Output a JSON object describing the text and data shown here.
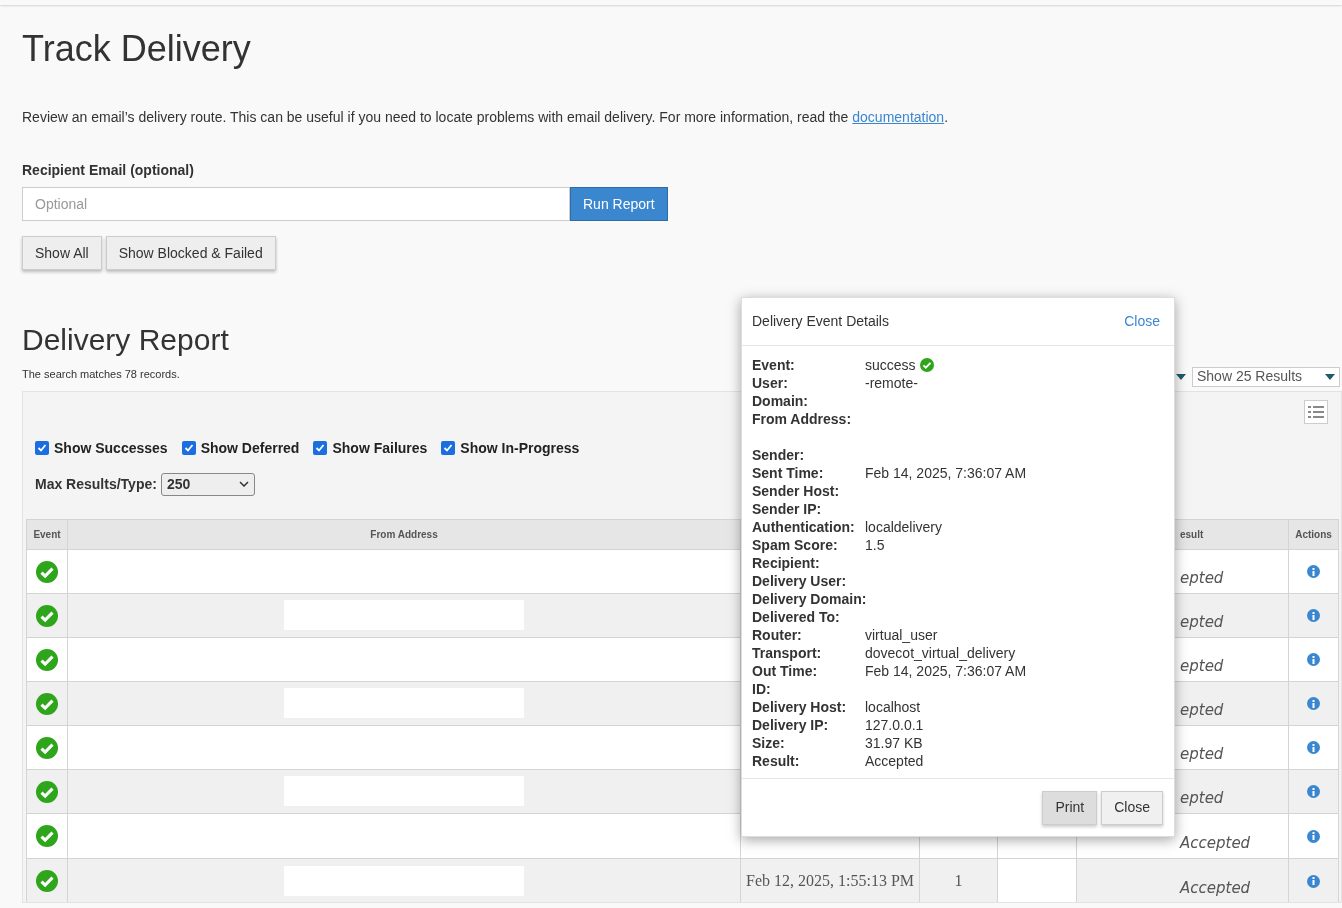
{
  "page": {
    "title": "Track Delivery",
    "description": "Review an email’s delivery route. This can be useful if you need to locate problems with email delivery. For more information, read the ",
    "description_link": "documentation",
    "description_end": "."
  },
  "recipient": {
    "label": "Recipient Email (optional)",
    "placeholder": "Optional",
    "run_button": "Run Report"
  },
  "filter_buttons": [
    "Show All",
    "Show Blocked & Failed"
  ],
  "report": {
    "title": "Delivery Report",
    "summary": "The search matches 78 records.",
    "results_select": "Show 25 Results"
  },
  "filters": [
    {
      "label": "Show Successes",
      "checked": true
    },
    {
      "label": "Show Deferred",
      "checked": true
    },
    {
      "label": "Show Failures",
      "checked": true
    },
    {
      "label": "Show In-Progress",
      "checked": true
    }
  ],
  "max_results": {
    "label": "Max Results/Type:",
    "value": "250"
  },
  "table": {
    "columns": [
      "Event",
      "From Address",
      "",
      "",
      "",
      "esult",
      "Actions"
    ],
    "rows": [
      {
        "from_redacted": false,
        "other_redacted": false,
        "result": "epted"
      },
      {
        "from_redacted": true,
        "other_redacted": false,
        "result": "epted"
      },
      {
        "from_redacted": false,
        "other_redacted": false,
        "result": "epted"
      },
      {
        "from_redacted": true,
        "other_redacted": false,
        "result": "epted"
      },
      {
        "from_redacted": false,
        "other_redacted": false,
        "result": "epted"
      },
      {
        "from_redacted": true,
        "other_redacted": false,
        "result": "epted"
      },
      {
        "from_redacted": false,
        "other_redacted": true,
        "result": "Accepted"
      },
      {
        "from_redacted": true,
        "time": "Feb 12, 2025, 1:55:13 PM",
        "count": "1",
        "other_redacted": true,
        "result": "Accepted"
      }
    ]
  },
  "dialog": {
    "title": "Delivery Event Details",
    "close_link": "Close",
    "groups": [
      [
        {
          "label": "Event:",
          "value": "success"
        },
        {
          "label": "User:",
          "value": "-remote-"
        },
        {
          "label": "Domain:"
        },
        {
          "label": "From Address:"
        }
      ],
      [
        {
          "label": "Sender:"
        },
        {
          "label": "Sent Time:",
          "value": "Feb 14, 2025, 7:36:07 AM"
        },
        {
          "label": "Sender Host:"
        },
        {
          "label": "Sender IP:"
        },
        {
          "label": "Authentication:",
          "value": "localdelivery"
        },
        {
          "label": "Spam Score:",
          "value": "1.5"
        },
        {
          "label": "Recipient:"
        },
        {
          "label": "Delivery User:"
        },
        {
          "label": "Delivery Domain:"
        },
        {
          "label": "Delivered To:"
        },
        {
          "label": "Router:",
          "value": "virtual_user"
        },
        {
          "label": "Transport:",
          "value": "dovecot_virtual_delivery"
        },
        {
          "label": "Out Time:",
          "value": "Feb 14, 2025, 7:36:07 AM"
        },
        {
          "label": "ID:"
        },
        {
          "label": "Delivery Host:",
          "value": "localhost"
        },
        {
          "label": "Delivery IP:",
          "value": "127.0.0.1"
        },
        {
          "label": "Size:",
          "value": "31.97 KB"
        },
        {
          "label": "Result:",
          "value": "Accepted"
        }
      ]
    ],
    "buttons": [
      "Print",
      "Close"
    ]
  }
}
